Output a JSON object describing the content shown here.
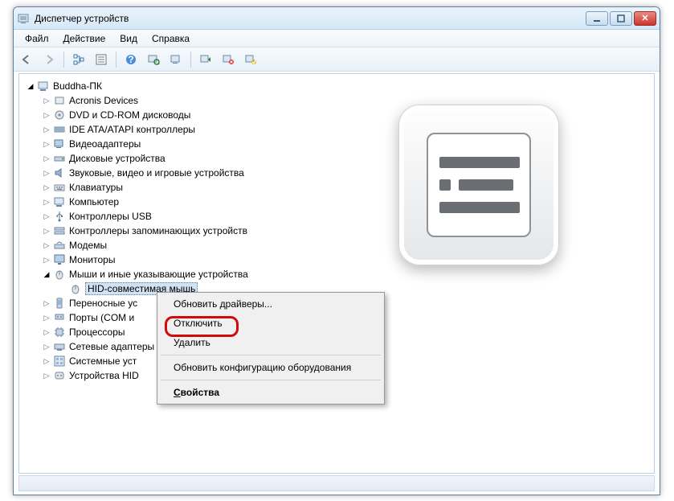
{
  "window": {
    "title": "Диспетчер устройств"
  },
  "menubar": [
    "Файл",
    "Действие",
    "Вид",
    "Справка"
  ],
  "tree": {
    "root": "Buddha-ПК",
    "categories": [
      "Acronis Devices",
      "DVD и CD-ROM дисководы",
      "IDE ATA/ATAPI контроллеры",
      "Видеоадаптеры",
      "Дисковые устройства",
      "Звуковые, видео и игровые устройства",
      "Клавиатуры",
      "Компьютер",
      "Контроллеры USB",
      "Контроллеры запоминающих устройств",
      "Модемы",
      "Мониторы",
      "Мыши и иные указывающие устройства",
      "Переносные устройства",
      "Порты (COM и LPT)",
      "Процессоры",
      "Сетевые адаптеры",
      "Системные устройства",
      "Устройства HID"
    ],
    "expanded_index": 12,
    "child_of_expanded": "HID-совместимая мышь"
  },
  "context_menu": {
    "items": [
      "Обновить драйверы...",
      "Отключить",
      "Удалить",
      "-",
      "Обновить конфигурацию оборудования",
      "-",
      "Свойства"
    ],
    "highlighted_index": 1,
    "bold_index": 6
  }
}
